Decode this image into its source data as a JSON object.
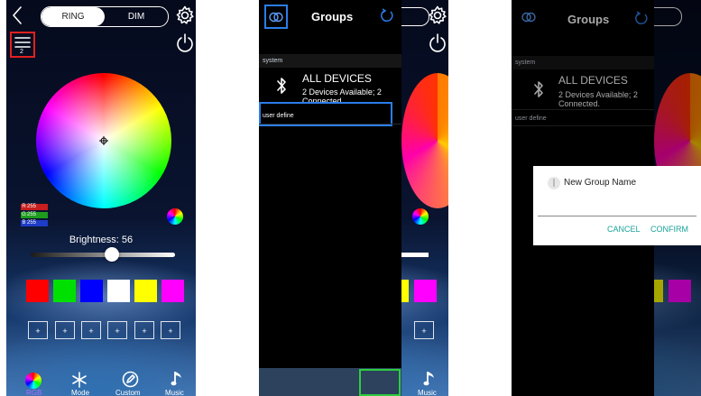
{
  "panel1": {
    "tabs": [
      "RING",
      "DIM"
    ],
    "menu_badge": "2",
    "rgb": {
      "r": "255",
      "g": "255",
      "b": "255"
    },
    "brightness_label": "Brightness: 56",
    "brightness": 56,
    "swatches": [
      "#ff0000",
      "#00e000",
      "#0000ff",
      "#ffffff",
      "#ffff00",
      "#ff00ff"
    ],
    "add_buttons": [
      "+",
      "+",
      "+",
      "+",
      "+",
      "+"
    ],
    "nav": [
      "RGB",
      "Mode",
      "Custom",
      "Music"
    ]
  },
  "panel2": {
    "title": "Groups",
    "section_system": "system",
    "device_name": "ALL DEVICES",
    "device_status": "2 Devices Available; 2 Connected.",
    "section_user": "user define",
    "nav_music": "Music"
  },
  "panel3": {
    "title": "Groups",
    "section_system": "system",
    "device_name": "ALL DEVICES",
    "device_status": "2 Devices Available; 2 Connected.",
    "section_user": "user define",
    "dialog_title": "New Group Name",
    "cancel": "CANCEL",
    "confirm": "CONFIRM"
  },
  "colors": {
    "accent_blue": "#2b7de9",
    "highlight_red": "#e02020",
    "highlight_green": "#2ecc40",
    "dialog_button": "#1aa39a"
  }
}
